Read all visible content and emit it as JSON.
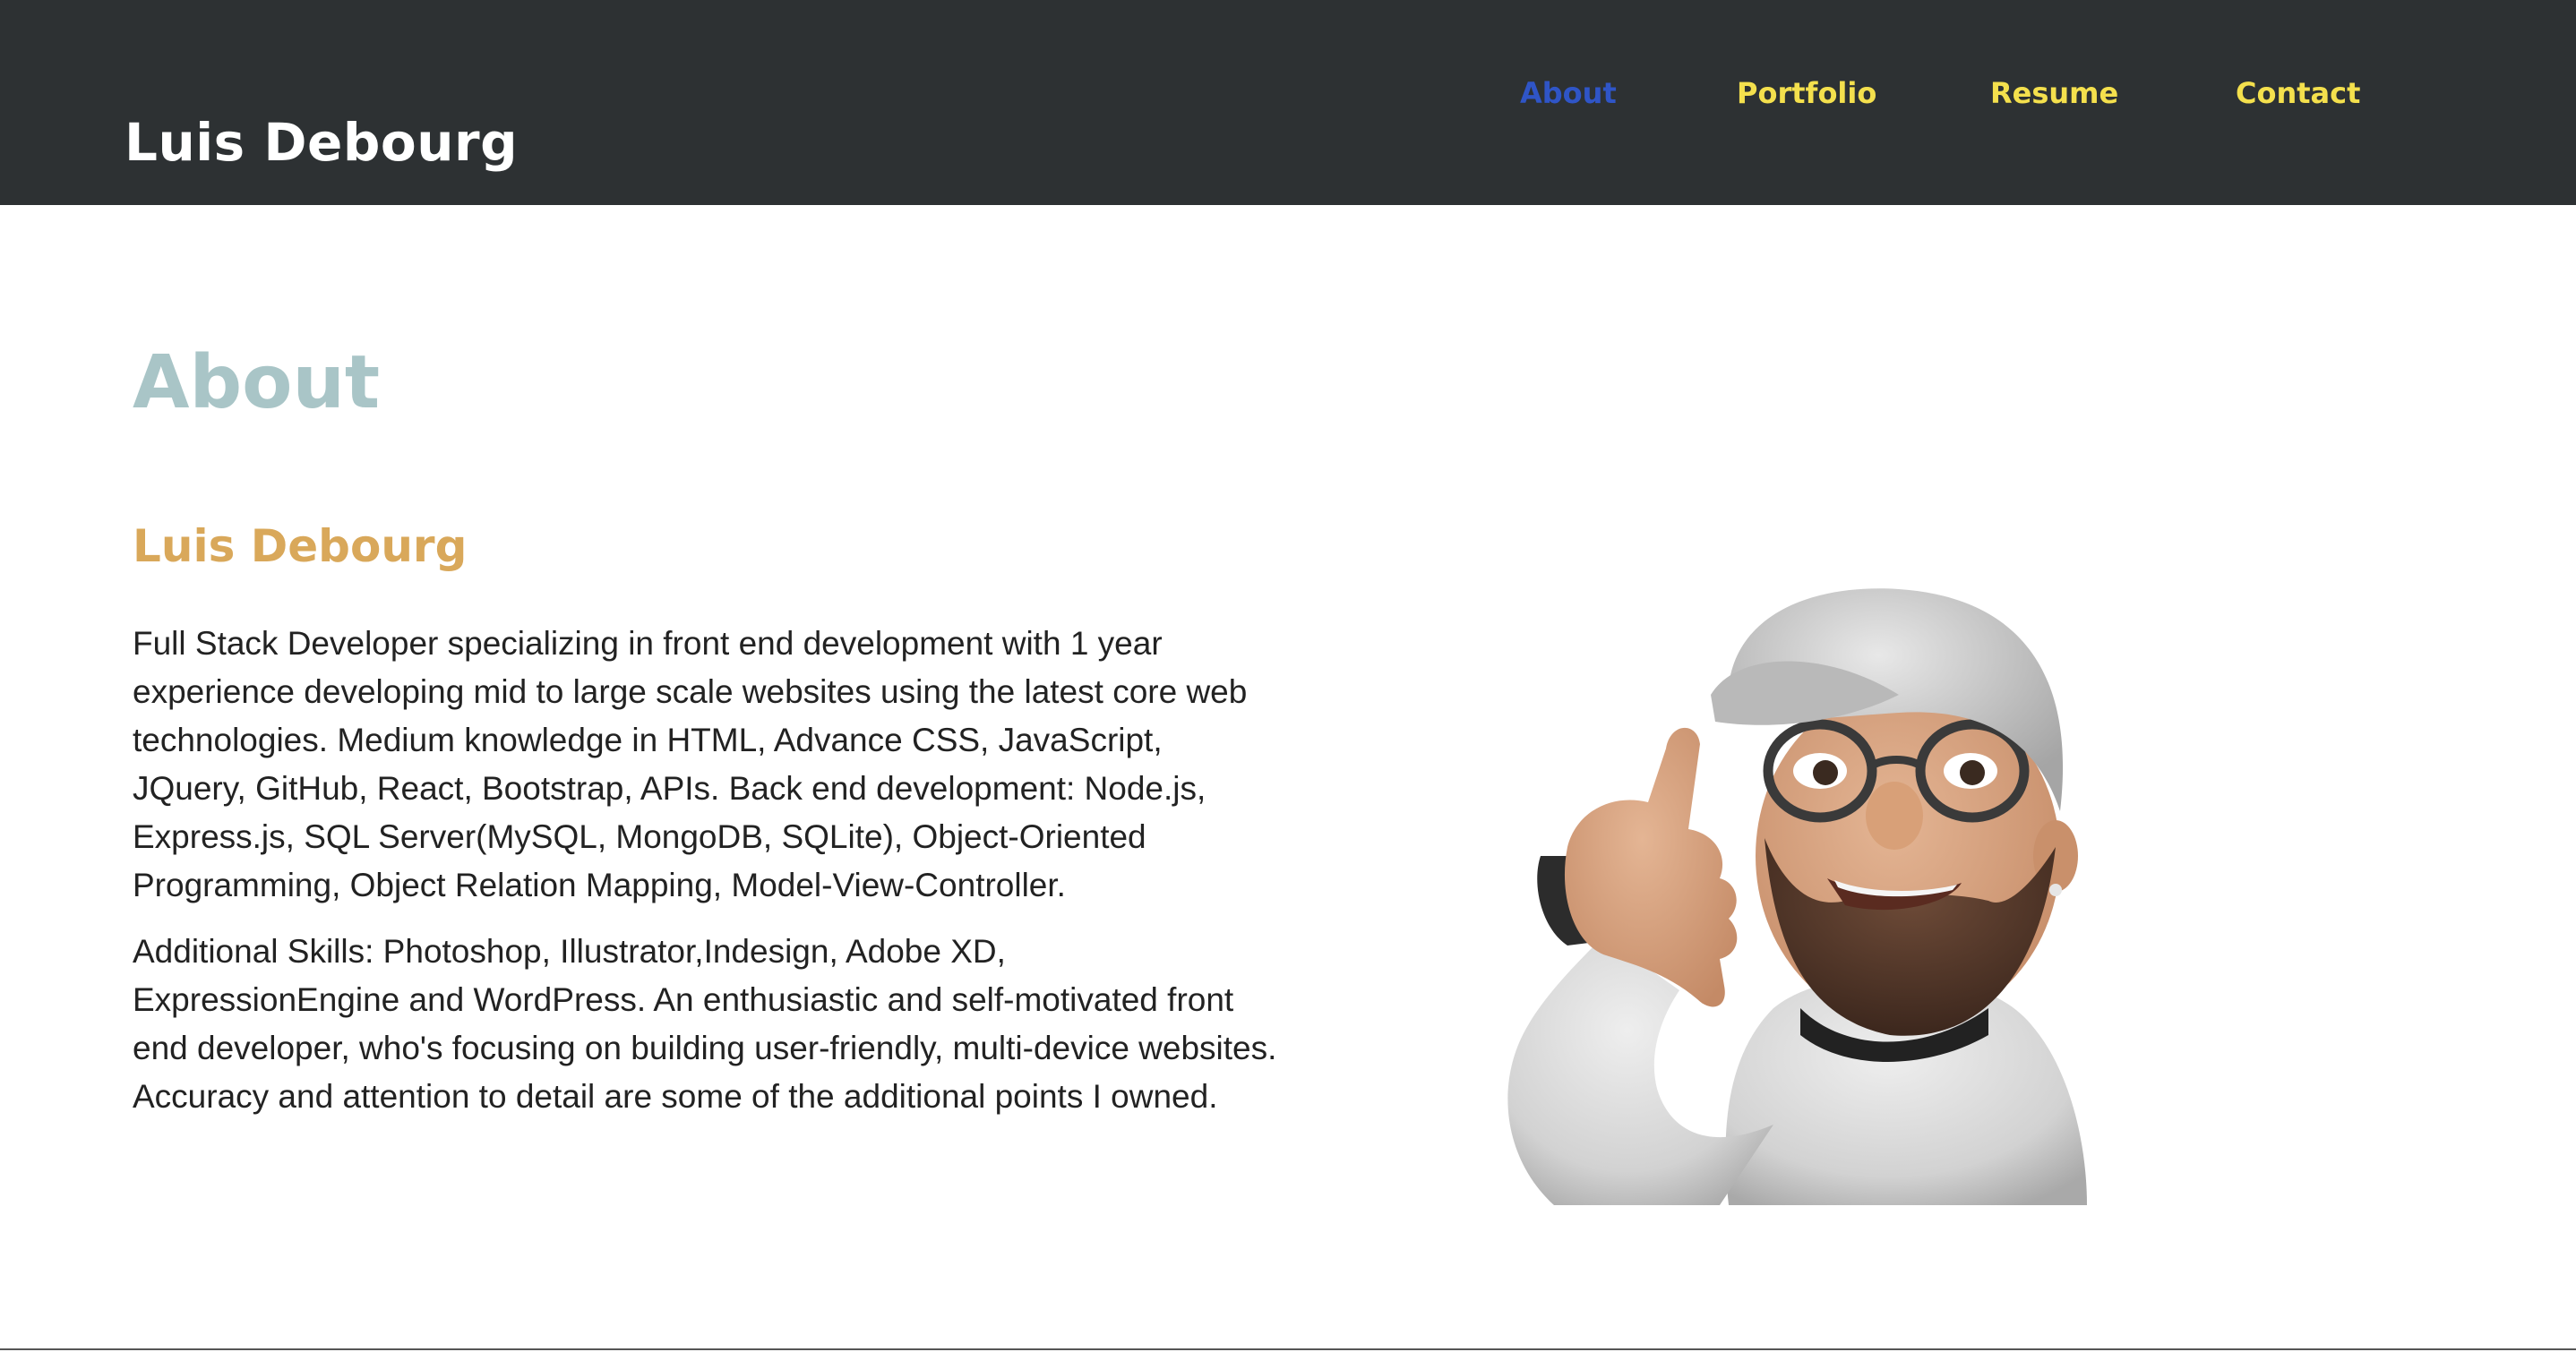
{
  "header": {
    "brand": "Luis Debourg",
    "nav": [
      {
        "label": "About",
        "active": true
      },
      {
        "label": "Portfolio",
        "active": false
      },
      {
        "label": "Resume",
        "active": false
      },
      {
        "label": "Contact",
        "active": false
      }
    ]
  },
  "about": {
    "title": "About",
    "name": "Luis Debourg",
    "paragraphs": [
      "Full Stack Developer specializing in front end development with 1 year experience developing mid to large scale websites using the latest core web technologies. Medium knowledge in HTML, Advance CSS, JavaScript, JQuery, GitHub, React, Bootstrap, APIs. Back end development: Node.js, Express.js, SQL Server(MySQL, MongoDB, SQLite), Object-Oriented Programming, Object Relation Mapping, Model-View-Controller.",
      "Additional Skills: Photoshop, Illustrator,Indesign, Adobe XD, ExpressionEngine and WordPress. An enthusiastic and self-motivated front end developer, who's focusing on building user-friendly, multi-device websites. Accuracy and attention to detail are some of the additional points I owned."
    ]
  },
  "colors": {
    "header_bg": "#2d3133",
    "nav_link": "#f4e04d",
    "nav_active": "#2f55c7",
    "about_title": "#a9c5c7",
    "name_accent": "#d9a85a"
  },
  "icons": {
    "avatar": "memoji-avatar-call-me-gesture"
  }
}
